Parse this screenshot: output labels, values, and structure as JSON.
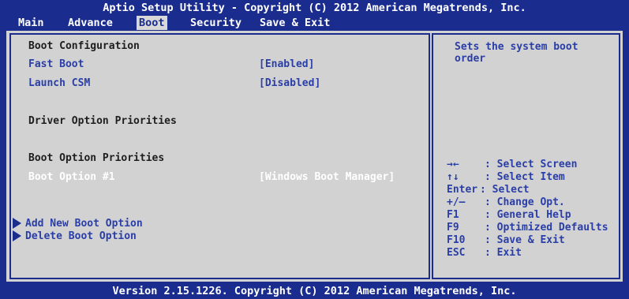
{
  "header": {
    "title": "Aptio Setup Utility - Copyright (C) 2012 American Megatrends, Inc."
  },
  "menu": {
    "items": [
      {
        "label": "Main"
      },
      {
        "label": "Advance"
      },
      {
        "label": "Boot"
      },
      {
        "label": "Security"
      },
      {
        "label": "Save & Exit"
      }
    ],
    "active": "Boot"
  },
  "left": {
    "boot_configuration": "Boot Configuration",
    "fast_boot": {
      "label": "Fast Boot",
      "value": "[Enabled]"
    },
    "launch_csm": {
      "label": "Launch CSM",
      "value": "[Disabled]"
    },
    "driver_option_priorities": "Driver Option Priorities",
    "boot_option_priorities": "Boot Option Priorities",
    "boot_option_1": {
      "label": "Boot Option #1",
      "value": "[Windows Boot Manager]"
    },
    "add_new_boot_option": "Add New Boot Option",
    "delete_boot_option": "Delete Boot Option"
  },
  "right": {
    "help_line1": "Sets the system boot",
    "help_line2": "order",
    "keys": [
      {
        "key": "→←",
        "desc": ": Select Screen"
      },
      {
        "key": "↑↓",
        "desc": ": Select Item"
      },
      {
        "key": "Enter",
        "desc": ": Select"
      },
      {
        "key": "+/—",
        "desc": ": Change Opt."
      },
      {
        "key": "F1",
        "desc": ": General Help"
      },
      {
        "key": "F9",
        "desc": ": Optimized Defaults"
      },
      {
        "key": "F10",
        "desc": ": Save & Exit"
      },
      {
        "key": "ESC",
        "desc": ": Exit"
      }
    ]
  },
  "footer": {
    "text": "Version 2.15.1226. Copyright (C) 2012 American Megatrends, Inc."
  },
  "colors": {
    "background": "#1a2d8e",
    "panel": "#d2d2d2",
    "highlight": "#ffffff",
    "option": "#2a3ea8"
  }
}
